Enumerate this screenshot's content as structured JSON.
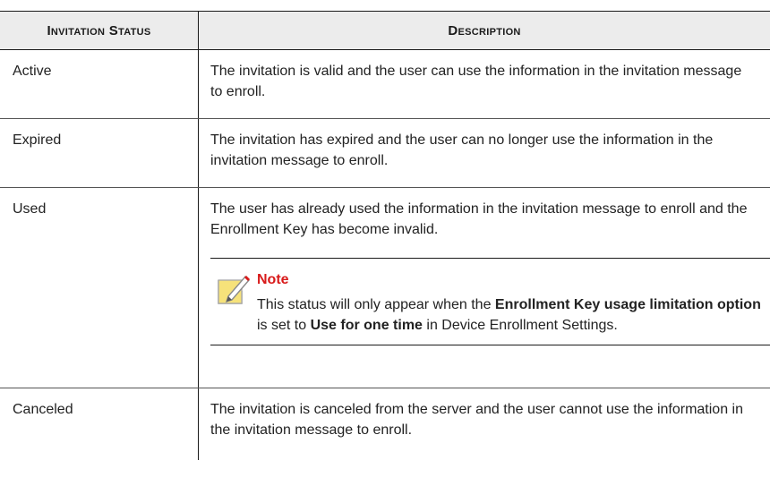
{
  "table": {
    "headers": [
      "Invitation Status",
      "Description"
    ],
    "rows": [
      {
        "status": "Active",
        "description": "The invitation is valid and the user can use the information in the invitation message to enroll."
      },
      {
        "status": "Expired",
        "description": "The invitation has expired and the user can no longer use the information in the invitation message to enroll."
      },
      {
        "status": "Used",
        "description": "The user has already used the information in the invitation message to enroll and the Enrollment Key has become invalid.",
        "note": {
          "title": "Note",
          "icon": "note-pencil-icon",
          "text_1": "This status will only appear when the ",
          "bold_1": "Enrollment Key usage limitation option",
          "text_2": " is set to ",
          "bold_2": "Use for one time",
          "text_3": " in Device Enrollment Settings."
        }
      },
      {
        "status": "Canceled",
        "description": "The invitation is canceled from the server and the user cannot use the information in the invitation message to enroll."
      }
    ]
  },
  "colors": {
    "header_bg": "#ececec",
    "note_title": "#d81a1a",
    "note_icon_fill": "#f6e27a"
  }
}
